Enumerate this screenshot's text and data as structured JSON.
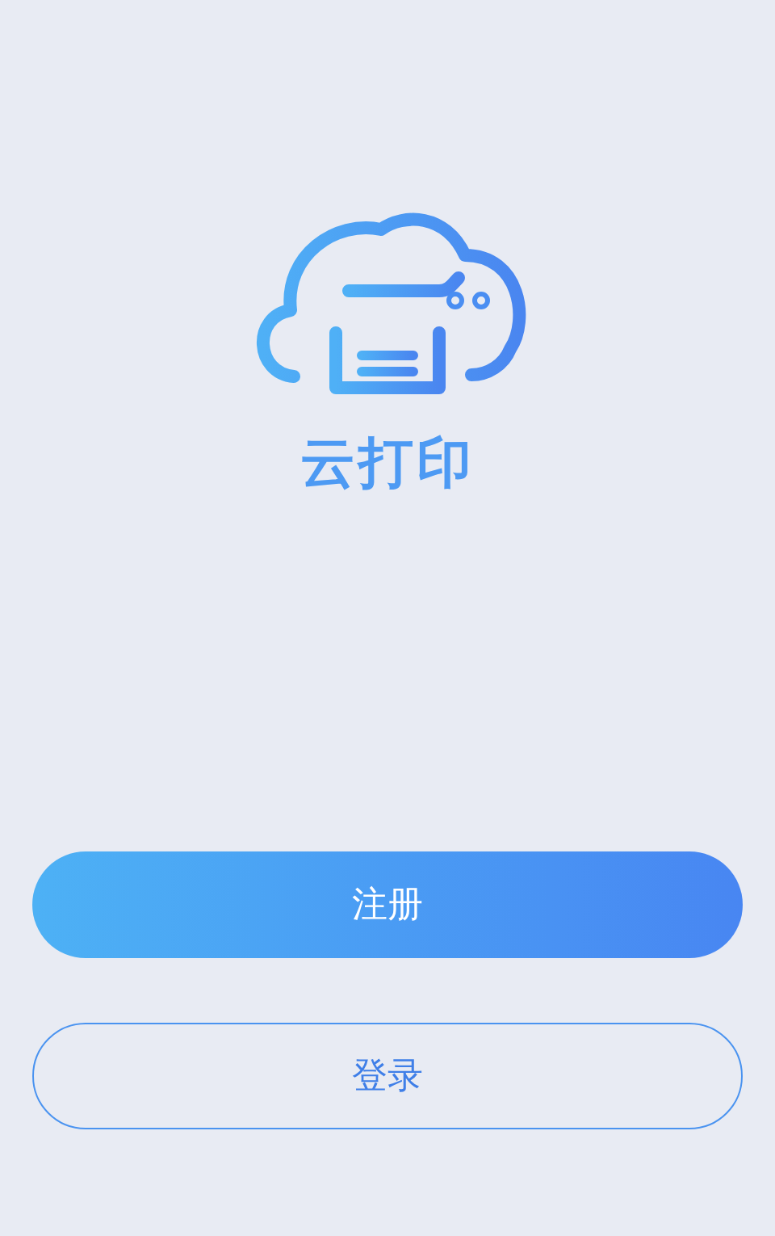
{
  "logo": {
    "title": "云打印"
  },
  "buttons": [
    {
      "kind": "primary",
      "label": "注册"
    },
    {
      "kind": "outline",
      "label": "登录"
    }
  ]
}
